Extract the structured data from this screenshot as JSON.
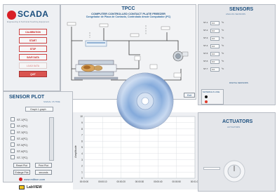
{
  "app": {
    "logo_text": "SCADA",
    "logo_sub": "Engineering & Technical Teaching Equipment",
    "title_code": "TPCC",
    "title_en": "COMPUTER CONTROLLED CONTACT PLATE FREEZER",
    "title_es": "Congelador de Placa de Contacto, Controlado desde Computador (PC)"
  },
  "control_buttons": [
    {
      "label": "CALIBRATION"
    },
    {
      "label": "START"
    },
    {
      "label": "STOP"
    },
    {
      "label": "SAVE DATA"
    },
    {
      "label": "LOAD DATA"
    },
    {
      "label": "QUIT"
    }
  ],
  "process": {
    "exit_button": "Exit"
  },
  "sensors_panel": {
    "title": "SENSORS",
    "subtitle": "ANALOG SENSORS",
    "rows": [
      {
        "label": "ST-1",
        "value": "0.0",
        "unit": "ºC"
      },
      {
        "label": "ST-2",
        "value": "0.0",
        "unit": "ºC"
      },
      {
        "label": "ST-3",
        "value": "0.0",
        "unit": "ºC"
      },
      {
        "label": "ST-4",
        "value": "0.0",
        "unit": "ºC"
      },
      {
        "label": "ST-5",
        "value": "0.0",
        "unit": "ºC"
      },
      {
        "label": "ST-6",
        "value": "0.0",
        "unit": "ºC"
      },
      {
        "label": "ST-7",
        "value": "0.0",
        "unit": "ºC"
      }
    ],
    "digital_title": "DIGITAL SENSORS",
    "materials_label": "MATERIALS LINE"
  },
  "actuators_panel": {
    "title": "ACTUATORS",
    "subtitle": "ACTUATORS"
  },
  "sensor_plot": {
    "title": "SENSOR PLOT",
    "subtitle": "SIGNAL VS TIME",
    "dropdown": "Graph 1 graph",
    "channels": [
      "ST-1(ºC)",
      "ST-2(ºC)",
      "ST-3(ºC)",
      "ST-4(ºC)",
      "ST-5(ºC)",
      "ST-6(ºC)",
      "ST-7(ºC)"
    ],
    "buttons": {
      "reset": "Reset Plot",
      "print": "Print Plot",
      "enlarge": "Enlarge Plot",
      "seconds": "seconds"
    },
    "ylabel": "Amplitude"
  },
  "chart_data": {
    "type": "line",
    "ylabel": "Amplitude",
    "yticks": [
      "10",
      "9",
      "8",
      "7",
      "6",
      "5",
      "4",
      "3",
      "2",
      "1",
      "0"
    ],
    "xticks": [
      "00:00:00",
      "00:00:10",
      "00:00:20",
      "00:00:30",
      "00:00:40",
      "00:00:50",
      "00:01:00"
    ],
    "ylim": [
      0,
      10
    ],
    "grid": true,
    "series": []
  },
  "footer": {
    "website": "www.edibon.com",
    "labview": "LabVIEW"
  },
  "colors": {
    "panel_bg": "#e4e6ea",
    "brand_blue": "#1c4f7e",
    "brand_red": "#d81f26",
    "button_red": "#c81e1e"
  }
}
